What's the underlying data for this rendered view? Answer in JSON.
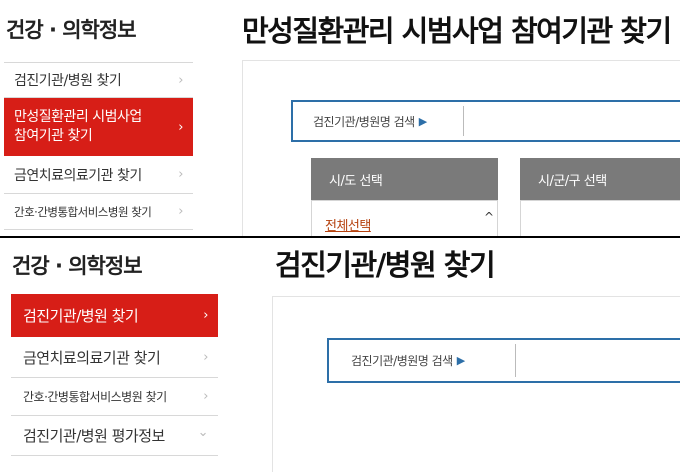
{
  "top": {
    "sidebar_title": "건강 · 의학정보",
    "page_title": "만성질환관리 시범사업 참여기관 찾기",
    "menu": [
      {
        "label": "검진기관/병원 찾기",
        "active": false
      },
      {
        "label_line1": "만성질환관리 시범사업",
        "label_line2": "참여기관 찾기",
        "active": true
      },
      {
        "label": "금연치료의료기관 찾기",
        "active": false
      },
      {
        "label": "간호·간병통합서비스병원 찾기",
        "active": false
      }
    ],
    "search_label": "검진기관/병원명 검색",
    "search_arrow": "▶",
    "columns": [
      "시/도 선택",
      "시/군/구 선택"
    ],
    "list_first_item": "전체선택"
  },
  "bottom": {
    "sidebar_title": "건강 · 의학정보",
    "page_title": "검진기관/병원 찾기",
    "menu": [
      {
        "label": "검진기관/병원 찾기",
        "active": true
      },
      {
        "label": "금연치료의료기관 찾기",
        "active": false
      },
      {
        "label": "간호·간병통합서비스병원 찾기",
        "active": false
      },
      {
        "label": "검진기관/병원 평가정보",
        "active": false
      }
    ],
    "search_label": "검진기관/병원명 검색",
    "search_arrow": "▶"
  },
  "icons": {
    "chevron_right": "›",
    "chevron_down": "⌄",
    "scroll_up": "^"
  },
  "colors": {
    "accent_red": "#d71e17",
    "search_blue": "#2d6fa8",
    "header_gray": "#7a7a7a",
    "link_orange": "#b5410e"
  }
}
